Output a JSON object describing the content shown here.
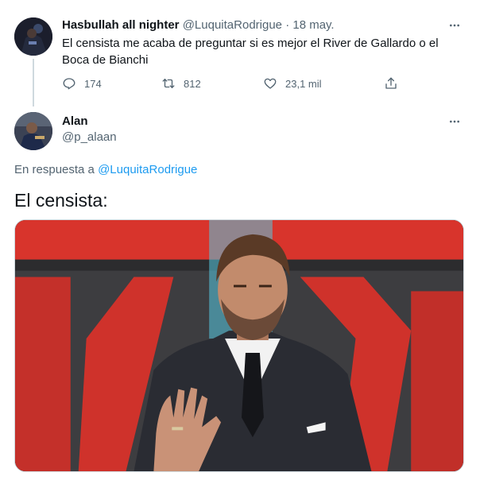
{
  "parent_tweet": {
    "display_name": "Hasbullah all nighter",
    "handle": "@LuquitaRodrigue",
    "separator": "·",
    "date": "18 may.",
    "text": "El censista me acaba de preguntar si es mejor el River de Gallardo o el Boca de Bianchi",
    "actions": {
      "replies": "174",
      "retweets": "812",
      "likes": "23,1 mil"
    }
  },
  "main_tweet": {
    "display_name": "Alan",
    "handle": "@p_alaan",
    "reply_prefix": "En respuesta a",
    "reply_handle": "@LuquitaRodrigue",
    "text": "El censista:"
  },
  "icons": {
    "more": "more-horizontal-icon",
    "reply": "reply-icon",
    "retweet": "retweet-icon",
    "like": "heart-icon",
    "share": "share-icon"
  },
  "colors": {
    "link": "#1d9bf0",
    "muted": "#536471",
    "text": "#0f1419",
    "thread_line": "#cfd9de"
  }
}
